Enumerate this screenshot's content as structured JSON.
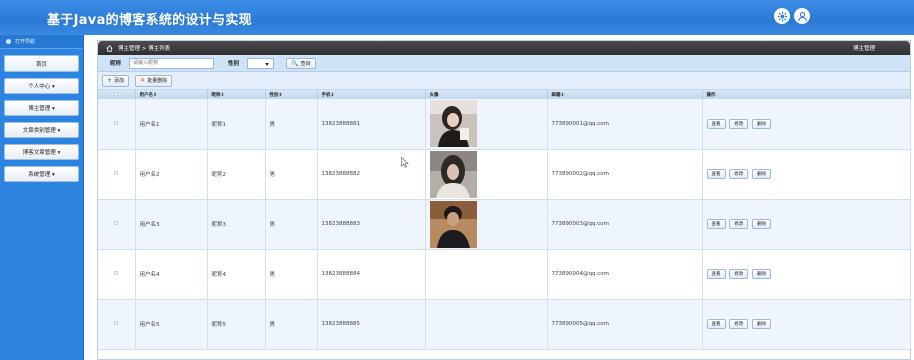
{
  "header": {
    "title": "基于Java的博客系统的设计与实现",
    "icons": [
      "settings-icon",
      "user-icon"
    ]
  },
  "sidebar": {
    "nav_title": "打开导航",
    "items": [
      {
        "label": "首页"
      },
      {
        "label": "个人中心 ▾"
      },
      {
        "label": "博主管理 ▾"
      },
      {
        "label": "文章类别管理 ▾"
      },
      {
        "label": "博客文章管理 ▾"
      },
      {
        "label": "系统管理 ▾"
      }
    ]
  },
  "breadcrumb": {
    "path": "博主管理 > 博主列表",
    "right": "博主管理"
  },
  "search": {
    "nickname_label": "昵称",
    "nickname_placeholder": "请输入昵称",
    "gender_label": "性别",
    "gender_value": "",
    "query_label": "查询"
  },
  "toolbar": {
    "add_label": "添加",
    "batch_delete_label": "批量删除"
  },
  "table": {
    "headers": [
      "用户名⇕",
      "昵称⇕",
      "性别⇕",
      "手机⇕",
      "头像",
      "邮箱⇕",
      "操作"
    ],
    "rows": [
      {
        "username": "用户名1",
        "nickname": "昵称1",
        "gender": "男",
        "phone": "13823888881",
        "avatar": "photo-1",
        "email": "773890001@qq.com"
      },
      {
        "username": "用户名2",
        "nickname": "昵称2",
        "gender": "男",
        "phone": "13823888882",
        "avatar": "photo-2",
        "email": "773890002@qq.com"
      },
      {
        "username": "用户名3",
        "nickname": "昵称3",
        "gender": "男",
        "phone": "13823888883",
        "avatar": "photo-3",
        "email": "773890003@qq.com"
      },
      {
        "username": "用户名4",
        "nickname": "昵称4",
        "gender": "男",
        "phone": "13823888884",
        "avatar": "",
        "email": "773890004@qq.com"
      },
      {
        "username": "用户名5",
        "nickname": "昵称5",
        "gender": "男",
        "phone": "13823888885",
        "avatar": "",
        "email": "773890005@qq.com"
      }
    ],
    "actions": {
      "view": "查看",
      "edit": "修改",
      "delete": "删除"
    }
  },
  "colors": {
    "header_blue": "#2b79d6",
    "sidebar_blue": "#2c84e0",
    "row_alt": "#eef5fd"
  }
}
